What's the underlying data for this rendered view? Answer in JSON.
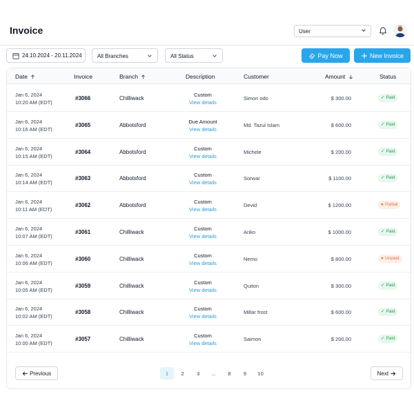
{
  "header": {
    "title": "Invoice",
    "user_select": "User"
  },
  "toolbar": {
    "date_range": "24.10.2024 - 20.11.2024",
    "branches": "All Branches",
    "status": "All Status",
    "pay_now": "Pay Now",
    "new_invoice": "New Invoice"
  },
  "table": {
    "columns": {
      "date": "Date",
      "invoice": "Invoice",
      "branch": "Branch",
      "description": "Description",
      "customer": "Customer",
      "amount": "Amount",
      "status": "Status"
    },
    "link_label": "View details",
    "rows": [
      {
        "date": "Jan 6, 2024",
        "time": "10:20 AM (EDT)",
        "invoice": "#3066",
        "branch": "Chilliwack",
        "description": "Custom",
        "customer": "Simon odo",
        "amount": "$ 300.00",
        "status": "Paid",
        "status_kind": "paid"
      },
      {
        "date": "Jan 6, 2024",
        "time": "10:16 AM (EDT)",
        "invoice": "#3065",
        "branch": "Abbotsford",
        "description": "Due Amount",
        "customer": "Md. Tazul Islam",
        "amount": "$ 600.00",
        "status": "Paid",
        "status_kind": "paid"
      },
      {
        "date": "Jan 6, 2024",
        "time": "10:15 AM (EDT)",
        "invoice": "#3064",
        "branch": "Abbotsford",
        "description": "Custom",
        "customer": "Michele",
        "amount": "$ 200.00",
        "status": "Paid",
        "status_kind": "paid"
      },
      {
        "date": "Jan 6, 2024",
        "time": "10:14 AM (EDT)",
        "invoice": "#3063",
        "branch": "Abbotsford",
        "description": "Custom",
        "customer": "Sorwar",
        "amount": "$ 1100.00",
        "status": "Paid",
        "status_kind": "paid"
      },
      {
        "date": "Jan 6, 2024",
        "time": "10:11 AM (EDT)",
        "invoice": "#3062",
        "branch": "Abbotsford",
        "description": "Custom",
        "customer": "Devid",
        "amount": "$ 1200.00",
        "status": "Partial",
        "status_kind": "partial"
      },
      {
        "date": "Jan 6, 2024",
        "time": "10:07 AM (EDT)",
        "invoice": "#3061",
        "branch": "Chilliwack",
        "description": "Custom",
        "customer": "Ariko",
        "amount": "$ 1000.00",
        "status": "Paid",
        "status_kind": "paid"
      },
      {
        "date": "Jan 6, 2024",
        "time": "10:06 AM (EDT)",
        "invoice": "#3060",
        "branch": "Chilliwack",
        "description": "Custom",
        "customer": "Nemo",
        "amount": "$ 800.00",
        "status": "Unpaid",
        "status_kind": "unpaid"
      },
      {
        "date": "Jan 6, 2024",
        "time": "10:05 AM (EDT)",
        "invoice": "#3059",
        "branch": "Chilliwack",
        "description": "Custom",
        "customer": "Quiton",
        "amount": "$ 300.00",
        "status": "Paid",
        "status_kind": "paid"
      },
      {
        "date": "Jan 6, 2024",
        "time": "10:02 AM (EDT)",
        "invoice": "#3058",
        "branch": "Chilliwack",
        "description": "Custom",
        "customer": "Millar frost",
        "amount": "$ 600.00",
        "status": "Paid",
        "status_kind": "paid"
      },
      {
        "date": "Jan 6, 2024",
        "time": "10:00 AM (EDT)",
        "invoice": "#3057",
        "branch": "Chilliwack",
        "description": "Custom",
        "customer": "Saimon",
        "amount": "$ 200.00",
        "status": "Paid",
        "status_kind": "paid"
      }
    ]
  },
  "pagination": {
    "previous": "Previous",
    "next": "Next",
    "pages": [
      "1",
      "2",
      "3",
      "...",
      "8",
      "9",
      "10"
    ],
    "current": "1"
  },
  "colors": {
    "accent": "#29a6e9",
    "paid": "#16a34a",
    "partial": "#e8703b",
    "unpaid": "#e8703b"
  },
  "icons": {
    "notifications": "bell-icon",
    "date": "calendar-icon",
    "dropdown": "chevron-down-icon",
    "pay": "pay-icon",
    "new": "plus-icon",
    "sort_asc": "arrow-up-icon",
    "sort_desc": "arrow-down-icon",
    "prev": "arrow-left-icon",
    "next": "arrow-right-icon"
  }
}
